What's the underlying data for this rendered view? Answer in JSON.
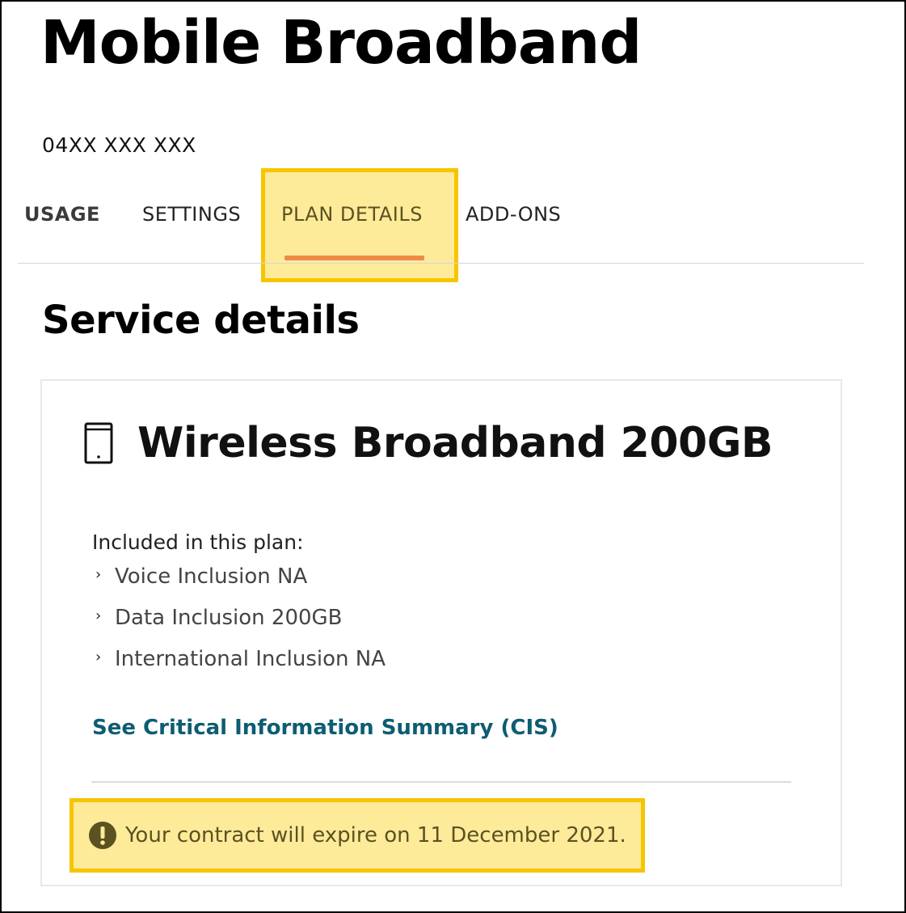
{
  "page": {
    "title": "Mobile Broadband",
    "service_number": "04XX XXX XXX"
  },
  "tabs": [
    {
      "label": "USAGE",
      "active": false
    },
    {
      "label": "SETTINGS",
      "active": false
    },
    {
      "label": "PLAN DETAILS",
      "active": true
    },
    {
      "label": "ADD-ONS",
      "active": false
    }
  ],
  "section": {
    "title": "Service details"
  },
  "plan": {
    "icon": "mobile-device-icon",
    "name": "Wireless Broadband 200GB",
    "included_label": "Included in this plan:",
    "inclusions": [
      "Voice Inclusion NA",
      "Data Inclusion 200GB",
      "International Inclusion NA"
    ],
    "cis_link": "See Critical Information Summary (CIS)"
  },
  "alert": {
    "icon": "exclamation-icon",
    "text": "Your contract will expire on 11 December 2021."
  },
  "colors": {
    "highlight_fill": "#fdeb9a",
    "highlight_border": "#f7c400",
    "active_tab_underline": "#ef8a45",
    "link": "#0d5d73"
  }
}
